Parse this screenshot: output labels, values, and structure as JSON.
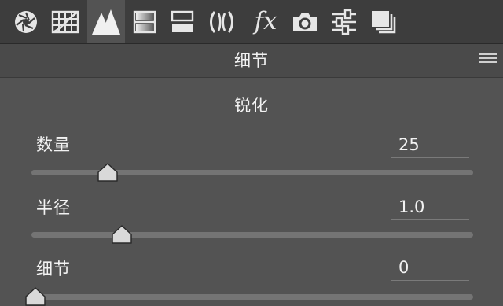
{
  "toolbar": {
    "tools": [
      {
        "icon": "aperture-icon",
        "active": false
      },
      {
        "icon": "tone-curve-grid-icon",
        "active": false
      },
      {
        "icon": "detail-triangles-icon",
        "active": true
      },
      {
        "icon": "hsl-gradient-icon",
        "active": false
      },
      {
        "icon": "split-toning-icon",
        "active": false
      },
      {
        "icon": "lens-correction-icon",
        "active": false
      },
      {
        "icon": "effects-fx-icon",
        "active": false
      },
      {
        "icon": "camera-calibration-icon",
        "active": false
      },
      {
        "icon": "presets-sliders-icon",
        "active": false
      },
      {
        "icon": "snapshots-stack-icon",
        "active": false
      }
    ],
    "fx_label": "fx"
  },
  "section": {
    "title": "细节"
  },
  "sharpening": {
    "title": "锐化",
    "sliders": [
      {
        "label": "数量",
        "value": "25",
        "position": 0.17
      },
      {
        "label": "半径",
        "value": "1.0",
        "position": 0.2
      },
      {
        "label": "细节",
        "value": "0",
        "position": 0.0
      }
    ]
  },
  "colors": {
    "panel_bg": "#535353",
    "toolbar_bg": "#3d3d3d",
    "track": "#747474",
    "thumb": "#d9d9d9"
  }
}
